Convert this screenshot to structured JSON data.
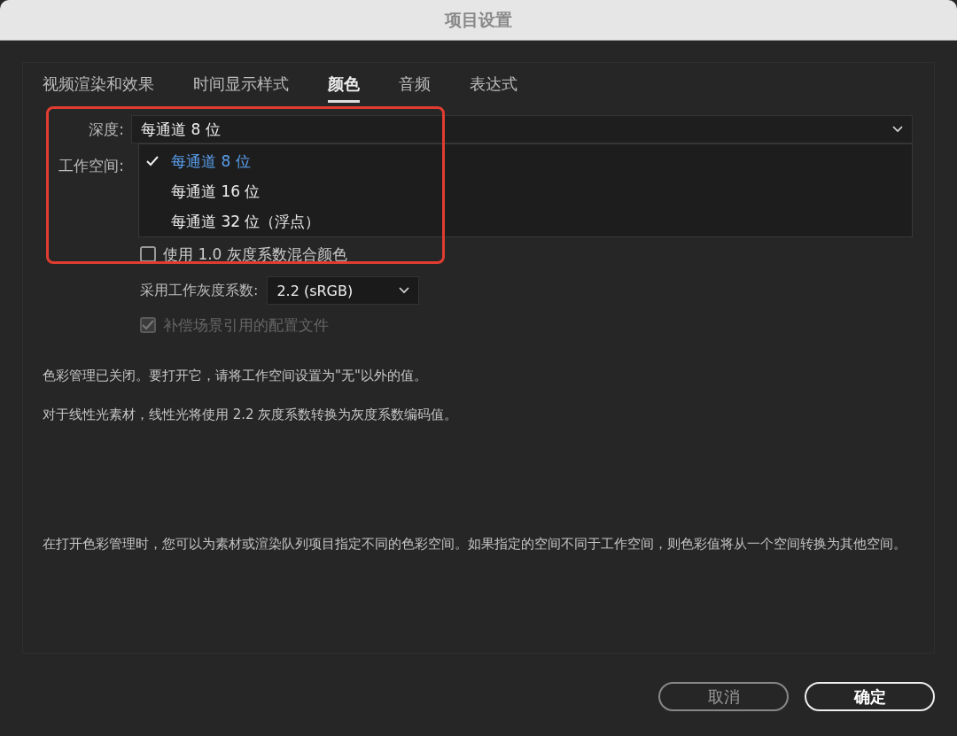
{
  "window": {
    "title": "项目设置"
  },
  "tabs": [
    {
      "label": "视频渲染和效果",
      "selected": false
    },
    {
      "label": "时间显示样式",
      "selected": false
    },
    {
      "label": "颜色",
      "selected": true
    },
    {
      "label": "音频",
      "selected": false
    },
    {
      "label": "表达式",
      "selected": false
    }
  ],
  "depth": {
    "label": "深度:",
    "value": "每通道 8 位",
    "menu": [
      {
        "label": "每通道 8 位",
        "selected": true
      },
      {
        "label": "每通道 16 位",
        "selected": false
      },
      {
        "label": "每通道 32 位（浮点）",
        "selected": false
      }
    ]
  },
  "workspace": {
    "label": "工作空间:"
  },
  "blend_checkbox": {
    "label": "使用 1.0 灰度系数混合颜色",
    "checked": false,
    "disabled": false
  },
  "gamma": {
    "label": "采用工作灰度系数:",
    "value": "2.2 (sRGB)"
  },
  "compensate_checkbox": {
    "label": "补偿场景引用的配置文件",
    "checked": true,
    "disabled": true
  },
  "notes": [
    "色彩管理已关闭。要打开它，请将工作空间设置为\"无\"以外的值。",
    "对于线性光素材，线性光将使用 2.2 灰度系数转换为灰度系数编码值。",
    "在打开色彩管理时，您可以为素材或渲染队列项目指定不同的色彩空间。如果指定的空间不同于工作空间，则色彩值将从一个空间转换为其他空间。"
  ],
  "buttons": [
    {
      "label": "取消",
      "kind": "secondary"
    },
    {
      "label": "确定",
      "kind": "primary"
    }
  ]
}
